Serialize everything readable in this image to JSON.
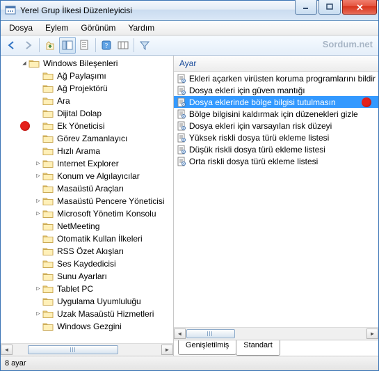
{
  "window": {
    "title": "Yerel Grup İlkesi Düzenleyicisi"
  },
  "menu": {
    "file": "Dosya",
    "action": "Eylem",
    "view": "Görünüm",
    "help": "Yardım"
  },
  "watermark": "Sordum.net",
  "tree": {
    "root": "Windows Bileşenleri",
    "items": [
      {
        "label": "Ağ Paylaşımı",
        "exp": ""
      },
      {
        "label": "Ağ Projektörü",
        "exp": ""
      },
      {
        "label": "Ara",
        "exp": ""
      },
      {
        "label": "Dijital Dolap",
        "exp": ""
      },
      {
        "label": "Ek Yöneticisi",
        "exp": "",
        "marker": true
      },
      {
        "label": "Görev Zamanlayıcı",
        "exp": ""
      },
      {
        "label": "Hızlı Arama",
        "exp": ""
      },
      {
        "label": "Internet Explorer",
        "exp": "▷"
      },
      {
        "label": "Konum ve Algılayıcılar",
        "exp": "▷"
      },
      {
        "label": "Masaüstü Araçları",
        "exp": ""
      },
      {
        "label": "Masaüstü Pencere Yöneticisi",
        "exp": "▷"
      },
      {
        "label": "Microsoft Yönetim Konsolu",
        "exp": "▷"
      },
      {
        "label": "NetMeeting",
        "exp": ""
      },
      {
        "label": "Otomatik Kullan İlkeleri",
        "exp": ""
      },
      {
        "label": "RSS Özet Akışları",
        "exp": ""
      },
      {
        "label": "Ses Kaydedicisi",
        "exp": ""
      },
      {
        "label": "Sunu Ayarları",
        "exp": ""
      },
      {
        "label": "Tablet PC",
        "exp": "▷"
      },
      {
        "label": "Uygulama Uyumluluğu",
        "exp": ""
      },
      {
        "label": "Uzak Masaüstü Hizmetleri",
        "exp": "▷"
      },
      {
        "label": "Windows Gezgini",
        "exp": ""
      }
    ]
  },
  "list": {
    "header": "Ayar",
    "items": [
      {
        "label": "Ekleri açarken virüsten koruma programlarını bildir",
        "sel": false
      },
      {
        "label": "Dosya ekleri için güven mantığı",
        "sel": false
      },
      {
        "label": "Dosya eklerinde bölge bilgisi tutulmasın",
        "sel": true,
        "marker": true
      },
      {
        "label": "Bölge bilgisini kaldırmak için düzenekleri gizle",
        "sel": false
      },
      {
        "label": "Dosya ekleri için varsayılan risk düzeyi",
        "sel": false
      },
      {
        "label": "Yüksek riskli dosya türü ekleme listesi",
        "sel": false
      },
      {
        "label": "Düşük riskli dosya türü ekleme listesi",
        "sel": false
      },
      {
        "label": "Orta riskli dosya türü ekleme listesi",
        "sel": false
      }
    ]
  },
  "tabs": {
    "ext": "Genişletilmiş",
    "std": "Standart"
  },
  "status": "8 ayar"
}
